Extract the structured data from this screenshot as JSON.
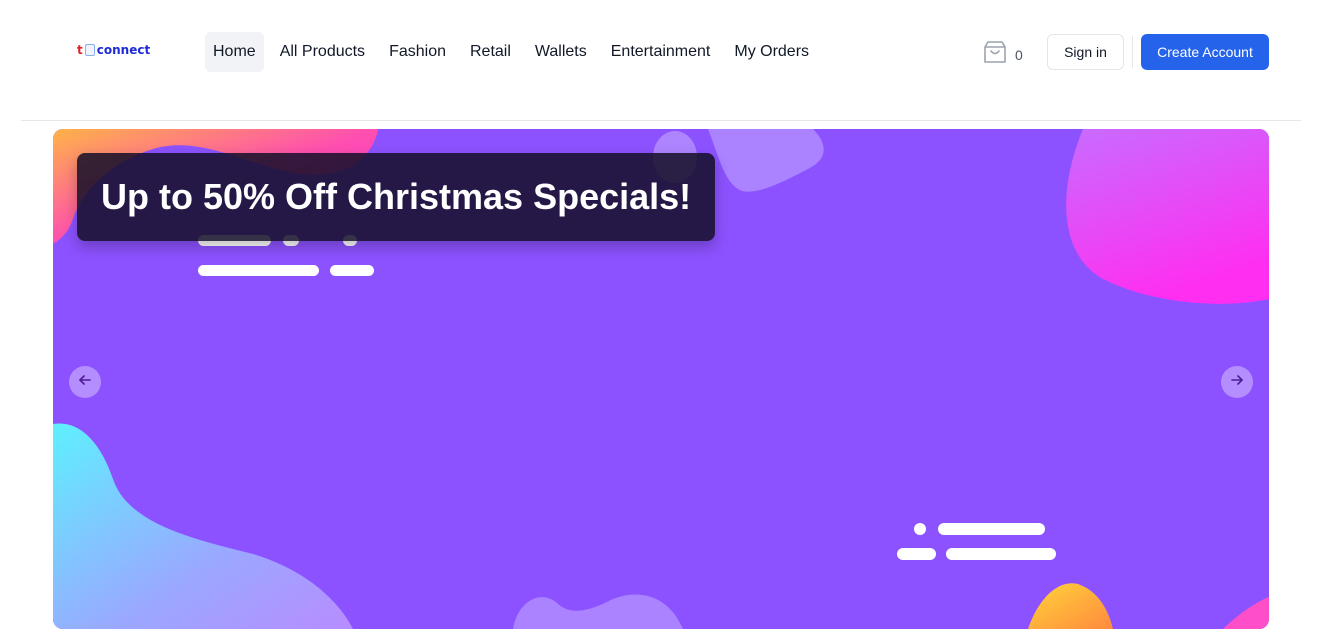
{
  "logo": {
    "text_t": "t",
    "text_main": "connect"
  },
  "nav": {
    "items": [
      {
        "label": "Home"
      },
      {
        "label": "All Products"
      },
      {
        "label": "Fashion"
      },
      {
        "label": "Retail"
      },
      {
        "label": "Wallets"
      },
      {
        "label": "Entertainment"
      },
      {
        "label": "My Orders"
      }
    ],
    "active_index": 0
  },
  "cart": {
    "count": "0",
    "icon": "shopping-bag-icon"
  },
  "auth": {
    "signin_label": "Sign in",
    "create_label": "Create Account"
  },
  "banner": {
    "headline": "Up to 50% Off Christmas Specials!",
    "background_color": "#8c52ff",
    "prev_icon": "arrow-left-icon",
    "next_icon": "arrow-right-icon"
  },
  "colors": {
    "primary": "#2563eb",
    "banner": "#8c52ff",
    "text": "#111827"
  }
}
